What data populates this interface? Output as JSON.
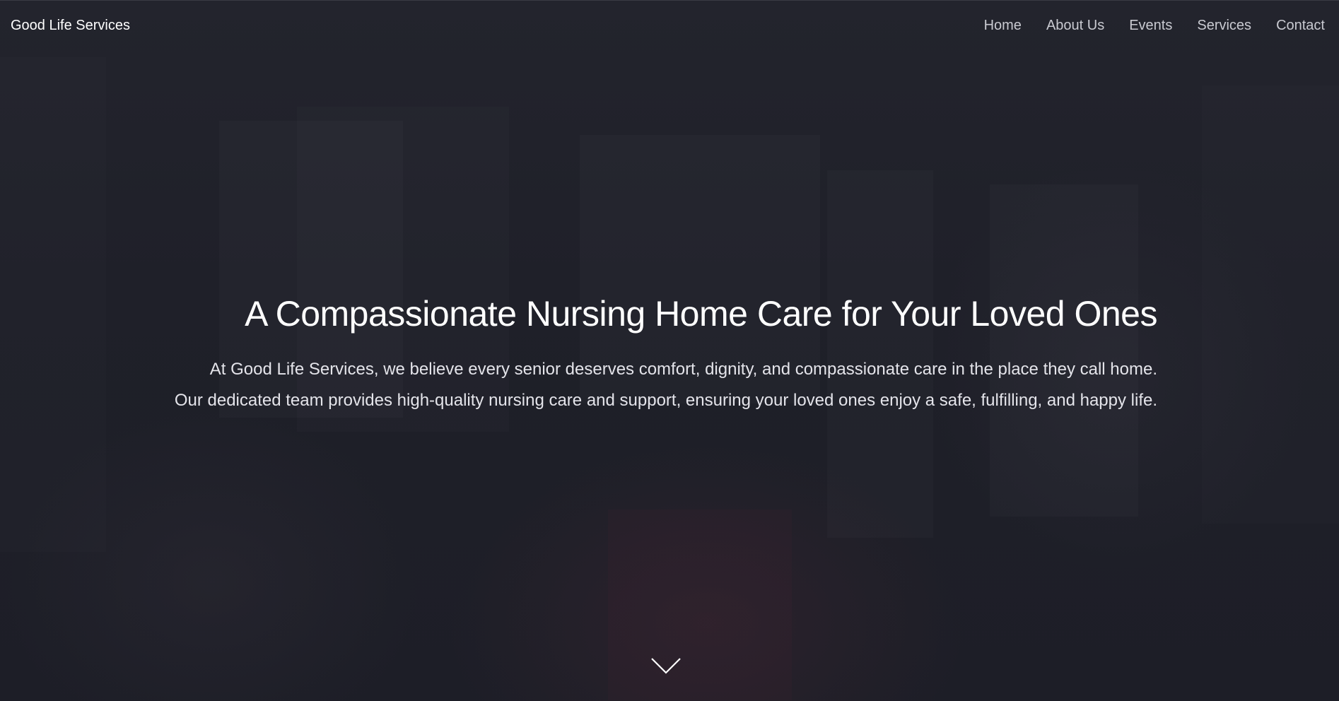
{
  "brand": "Good Life Services",
  "nav": {
    "items": [
      {
        "label": "Home"
      },
      {
        "label": "About Us"
      },
      {
        "label": "Events"
      },
      {
        "label": "Services"
      },
      {
        "label": "Contact"
      }
    ]
  },
  "hero": {
    "headline": "A Compassionate Nursing Home Care for Your Loved Ones",
    "lead_line_1": "At Good Life Services, we believe every senior deserves comfort, dignity, and compassionate care in the place they call home.",
    "lead_line_2": "Our dedicated team provides high-quality nursing care and support, ensuring your loved ones enjoy a safe, fulfilling, and happy life.",
    "scroll_icon": "chevron-down-icon"
  },
  "colors": {
    "background_overlay": "#1e1f28",
    "text_primary": "#ffffff",
    "nav_text": "#c9cad1"
  }
}
